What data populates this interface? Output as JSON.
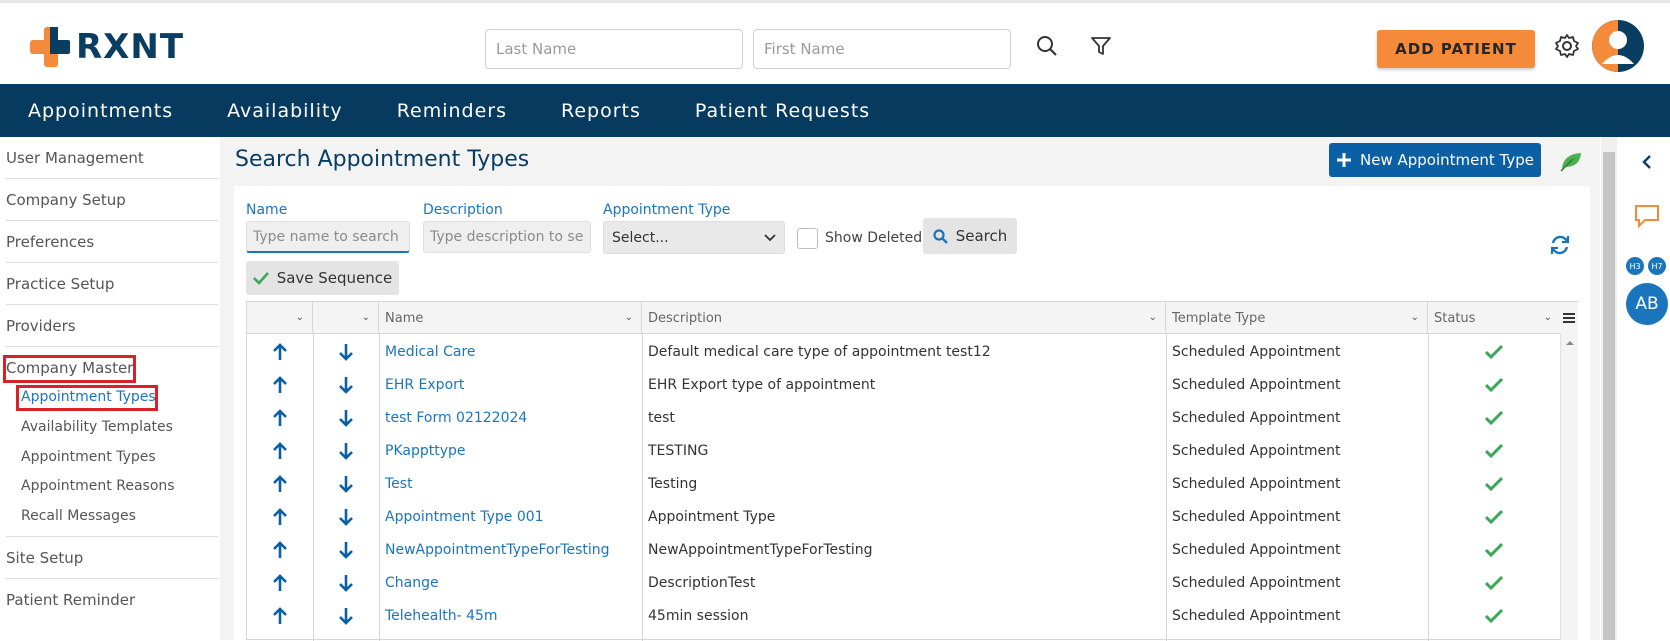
{
  "brand": {
    "name": "RXNT"
  },
  "header": {
    "last_name_placeholder": "Last Name",
    "first_name_placeholder": "First Name",
    "add_patient_label": "ADD PATIENT"
  },
  "nav": [
    "Appointments",
    "Availability",
    "Reminders",
    "Reports",
    "Patient Requests"
  ],
  "sidebar": {
    "items": [
      "User Management",
      "Company Setup",
      "Preferences",
      "Practice Setup",
      "Providers",
      "Company Master"
    ],
    "sub_items": [
      "Appointment Types",
      "Availability Templates",
      "Appointment Types",
      "Appointment Reasons",
      "Recall Messages"
    ],
    "bottom_items": [
      "Site Setup",
      "Patient Reminder"
    ]
  },
  "page": {
    "title": "Search Appointment Types",
    "new_button": "New Appointment Type"
  },
  "filters": {
    "name_label": "Name",
    "name_placeholder": "Type name to search",
    "description_label": "Description",
    "description_placeholder": "Type description to search",
    "type_label": "Appointment Type",
    "type_value": "Select...",
    "show_deleted": "Show Deleted",
    "search_button": "Search",
    "save_sequence": "Save Sequence"
  },
  "table": {
    "columns": [
      "Name",
      "Description",
      "Template Type",
      "Status"
    ],
    "rows": [
      {
        "name": "Medical Care",
        "description": "Default medical care type of appointment test12",
        "template": "Scheduled Appointment"
      },
      {
        "name": "EHR Export",
        "description": "EHR Export type of appointment",
        "template": "Scheduled Appointment"
      },
      {
        "name": "test Form 02122024",
        "description": "test",
        "template": "Scheduled Appointment"
      },
      {
        "name": "PKappttype",
        "description": "TESTING",
        "template": "Scheduled Appointment"
      },
      {
        "name": "Test",
        "description": "Testing",
        "template": "Scheduled Appointment"
      },
      {
        "name": "Appointment Type 001",
        "description": "Appointment Type",
        "template": "Scheduled Appointment"
      },
      {
        "name": "NewAppointmentTypeForTesting",
        "description": "NewAppointmentTypeForTesting",
        "template": "Scheduled Appointment"
      },
      {
        "name": "Change",
        "description": "DescriptionTest",
        "template": "Scheduled Appointment"
      },
      {
        "name": "Telehealth- 45m",
        "description": "45min session",
        "template": "Scheduled Appointment"
      }
    ]
  },
  "right_rail": {
    "badge1": "H3",
    "badge2": "H7",
    "avatar": "AB"
  },
  "colors": {
    "brand_navy": "#063a5f",
    "accent_orange": "#f58a3a",
    "link_blue": "#1b75bc",
    "status_green": "#3aa856"
  }
}
